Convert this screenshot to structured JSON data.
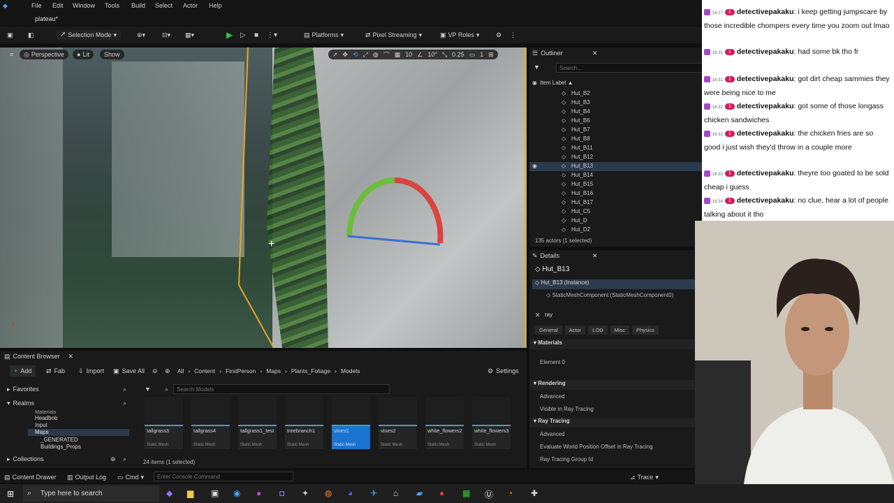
{
  "menu": {
    "items": [
      "File",
      "Edit",
      "Window",
      "Tools",
      "Build",
      "Select",
      "Actor",
      "Help"
    ],
    "level_tab": "plateau*"
  },
  "toolbar": {
    "mode": "Selection Mode",
    "platforms": "Platforms",
    "pixel_streaming": "Pixel Streaming",
    "vp_roles": "VP Roles"
  },
  "viewport": {
    "perspective": "Perspective",
    "lit": "Lit",
    "show": "Show",
    "grid": "10",
    "angle": "10°",
    "scale": "0.25",
    "camera": "1"
  },
  "outliner": {
    "title": "Outliner",
    "search_placeholder": "Search...",
    "column": "Item Label ▲",
    "items": [
      "Hut_B2",
      "Hut_B3",
      "Hut_B4",
      "Hut_B6",
      "Hut_B7",
      "Hut_B8",
      "Hut_B11",
      "Hut_B12",
      "Hut_B13",
      "Hut_B14",
      "Hut_B15",
      "Hut_B16",
      "Hut_B17",
      "Hut_C5",
      "Hut_D",
      "Hut_D2"
    ],
    "selected": "Hut_B13",
    "status": "135 actors (1 selected)"
  },
  "details": {
    "title": "Details",
    "actor": "Hut_B13",
    "instance": "Hut_B13 (Instance)",
    "component": "StaticMeshComponent (StaticMeshComponent0)",
    "filter": "ray",
    "tabs": [
      "General",
      "Actor",
      "LOD",
      "Misc",
      "Physics"
    ],
    "sections": {
      "materials": "Materials",
      "element0": "Element 0",
      "rendering": "Rendering",
      "advanced1": "Advanced",
      "visible_ray": "Visible in Ray Tracing",
      "ray_tracing": "Ray Tracing",
      "advanced2": "Advanced",
      "evaluate": "Evaluate World Position Offset in Ray Tracing",
      "group_id": "Ray Tracing Group Id"
    }
  },
  "content_browser": {
    "title": "Content Browser",
    "add": "Add",
    "fab": "Fab",
    "import": "Import",
    "save_all": "Save All",
    "breadcrumb": [
      "All",
      "Content",
      "FirstPerson",
      "Maps",
      "Plants_Foliage",
      "Models"
    ],
    "settings": "Settings",
    "favorites": "Favorites",
    "realms": "Realms",
    "tree": [
      "Materials",
      "Headbob",
      "Input",
      "Maps",
      "_GENERATED",
      "Buildings_Props"
    ],
    "collections": "Collections",
    "search_placeholder": "Search Models",
    "assets": [
      {
        "name": "tallgrass3",
        "type": "Static Mesh"
      },
      {
        "name": "tallgrass4",
        "type": "Static Mesh"
      },
      {
        "name": "tallgrass1_test",
        "type": "Static Mesh"
      },
      {
        "name": "treebranch1",
        "type": "Static Mesh"
      },
      {
        "name": "vines1",
        "type": "Static Mesh"
      },
      {
        "name": "vines2",
        "type": "Static Mesh"
      },
      {
        "name": "white_flowers2",
        "type": "Static Mesh"
      },
      {
        "name": "white_flowers3",
        "type": "Static Mesh"
      }
    ],
    "count": "24 items (1 selected)"
  },
  "status_bar": {
    "content_drawer": "Content Drawer",
    "output_log": "Output Log",
    "cmd": "Cmd",
    "console_placeholder": "Enter Console Command",
    "trace": "Trace"
  },
  "taskbar": {
    "search": "Type here to search"
  },
  "chat": {
    "messages": [
      {
        "time": "16:27",
        "user": "detectivepakaku",
        "text": "i keep getting jumpscare by those incredible chompers every time you zoom out lmao"
      },
      {
        "time": "16:31",
        "user": "detectivepakaku",
        "text": "had some bk tho fr"
      },
      {
        "time": "16:31",
        "user": "detectivepakaku",
        "text": "got dirt cheap sammies they were being nice to me"
      },
      {
        "time": "16:32",
        "user": "detectivepakaku",
        "text": "got some of those longass chicken sandwiches"
      },
      {
        "time": "16:32",
        "user": "detectivepakaku",
        "text": "the chicken fries are so good i just wish they'd throw in a couple more"
      },
      {
        "time": "16:33",
        "user": "detectivepakaku",
        "text": "theyre too goated to be sold cheap i guess"
      },
      {
        "time": "16:34",
        "user": "detectivepakaku",
        "text": "no clue, hear a lot of people talking about it tho"
      }
    ]
  }
}
